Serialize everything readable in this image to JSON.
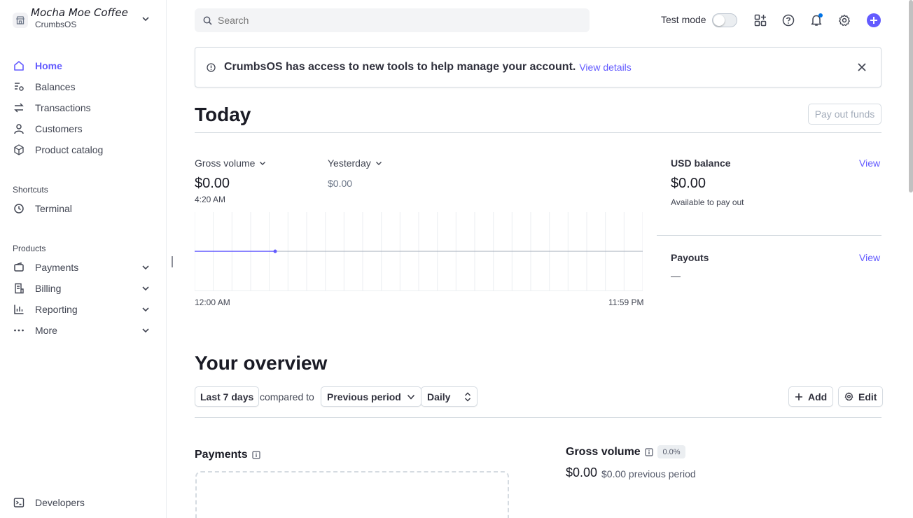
{
  "account": {
    "name": "Mocha Moe Coffee",
    "platform": "CrumbsOS"
  },
  "nav": {
    "main": [
      {
        "label": "Home",
        "icon": "home-icon",
        "active": true
      },
      {
        "label": "Balances",
        "icon": "balances-icon"
      },
      {
        "label": "Transactions",
        "icon": "transactions-icon"
      },
      {
        "label": "Customers",
        "icon": "customers-icon"
      },
      {
        "label": "Product catalog",
        "icon": "product-catalog-icon"
      }
    ],
    "shortcuts_title": "Shortcuts",
    "shortcuts": [
      {
        "label": "Terminal",
        "icon": "clock-icon"
      }
    ],
    "products_title": "Products",
    "products": [
      {
        "label": "Payments",
        "icon": "wallet-icon"
      },
      {
        "label": "Billing",
        "icon": "billing-icon"
      },
      {
        "label": "Reporting",
        "icon": "reporting-icon"
      },
      {
        "label": "More",
        "icon": "more-icon"
      }
    ],
    "developers": {
      "label": "Developers",
      "icon": "terminal-icon"
    }
  },
  "topbar": {
    "search_placeholder": "Search",
    "test_mode_label": "Test mode",
    "test_mode_on": false
  },
  "banner": {
    "text": "CrumbsOS has access to new tools to help manage your account.",
    "link": "View details"
  },
  "today": {
    "title": "Today",
    "payout_button": "Pay out funds",
    "gross_volume_label": "Gross volume",
    "gross_volume_value": "$0.00",
    "gross_volume_time": "4:20 AM",
    "yesterday_label": "Yesterday",
    "yesterday_value": "$0.00",
    "chart_start": "12:00 AM",
    "chart_end": "11:59 PM",
    "usd_balance_label": "USD balance",
    "usd_balance_value": "$0.00",
    "usd_balance_sub": "Available to pay out",
    "view_link": "View",
    "payouts_label": "Payouts",
    "payouts_view": "View",
    "payouts_value": "—"
  },
  "overview": {
    "title": "Your overview",
    "range": "Last 7 days",
    "compared_to": "compared to",
    "comparison": "Previous period",
    "granularity": "Daily",
    "add_button": "Add",
    "edit_button": "Edit",
    "payments_title": "Payments",
    "gross_volume_title": "Gross volume",
    "gross_volume_badge": "0.0%",
    "gross_volume_value": "$0.00",
    "gross_volume_previous": "$0.00 previous period"
  },
  "colors": {
    "accent": "#635bff",
    "text": "#30313d",
    "border": "#d5dbe1"
  }
}
